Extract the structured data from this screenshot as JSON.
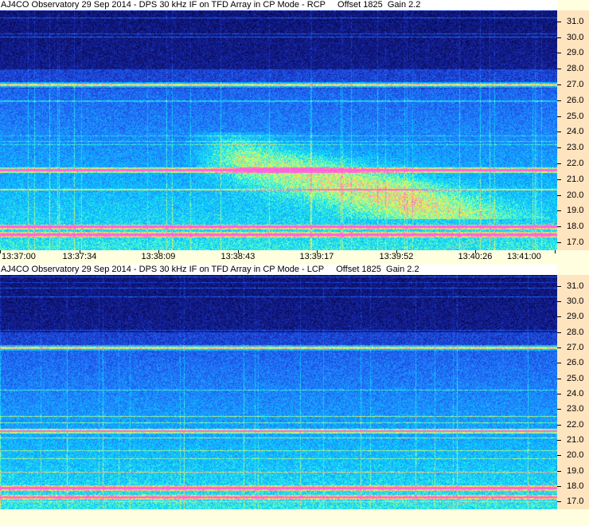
{
  "panels": [
    {
      "title": "AJ4CO Observatory 29 Sep 2014 - DPS 30 kHz IF on TFD Array in CP Mode - RCP     Offset 1825  Gain 2.2",
      "polarization": "RCP",
      "y_ticks": [
        "31.0",
        "30.0",
        "29.0",
        "28.0",
        "27.0",
        "26.0",
        "25.0",
        "24.0",
        "23.0",
        "22.0",
        "21.0",
        "20.0",
        "19.0",
        "18.0",
        "17.0"
      ],
      "x_ticks": [
        "13:37:00",
        "13:37:34",
        "13:38:09",
        "13:38:43",
        "13:39:17",
        "13:39:52",
        "13:40:26",
        "13:41:00"
      ]
    },
    {
      "title": "AJ4CO Observatory 29 Sep 2014 - DPS 30 kHz IF on TFD Array in CP Mode - LCP     Offset 1825  Gain 2.2",
      "polarization": "LCP",
      "y_ticks": [
        "31.0",
        "30.0",
        "29.0",
        "28.0",
        "27.0",
        "26.0",
        "25.0",
        "24.0",
        "23.0",
        "22.0",
        "21.0",
        "20.0",
        "19.0",
        "18.0",
        "17.0"
      ],
      "x_ticks": []
    }
  ],
  "chart_data": [
    {
      "type": "heatmap",
      "title": "AJ4CO Observatory 29 Sep 2014 - DPS 30 kHz IF on TFD Array in CP Mode - RCP     Offset 1825  Gain 2.2",
      "x_range": [
        "13:37:00",
        "13:41:00"
      ],
      "y_range": [
        16.5,
        31.7
      ],
      "y_ticks": [
        31,
        30,
        29,
        28,
        27,
        26,
        25,
        24,
        23,
        22,
        21,
        20,
        19,
        18,
        17
      ],
      "colormap": [
        "#0a0a5a",
        "#1e3cc8",
        "#1e90ff",
        "#00d2ff",
        "#7cffb0",
        "#ffff40",
        "#ff80c0"
      ],
      "interference_bands_mhz": [
        27.0,
        21.6,
        18.0,
        17.5
      ]
    },
    {
      "type": "heatmap",
      "title": "AJ4CO Observatory 29 Sep 2014 - DPS 30 kHz IF on TFD Array in CP Mode - LCP     Offset 1825  Gain 2.2",
      "x_range": [
        "13:37:00",
        "13:41:00"
      ],
      "y_range": [
        16.5,
        31.7
      ],
      "y_ticks": [
        31,
        30,
        29,
        28,
        27,
        26,
        25,
        24,
        23,
        22,
        21,
        20,
        19,
        18,
        17
      ],
      "colormap": [
        "#0a0a5a",
        "#1e3cc8",
        "#1e90ff",
        "#00d2ff",
        "#7cffb0",
        "#ffff40",
        "#ff80c0"
      ],
      "interference_bands_mhz": [
        27.0,
        21.6,
        17.9,
        17.3
      ]
    }
  ]
}
